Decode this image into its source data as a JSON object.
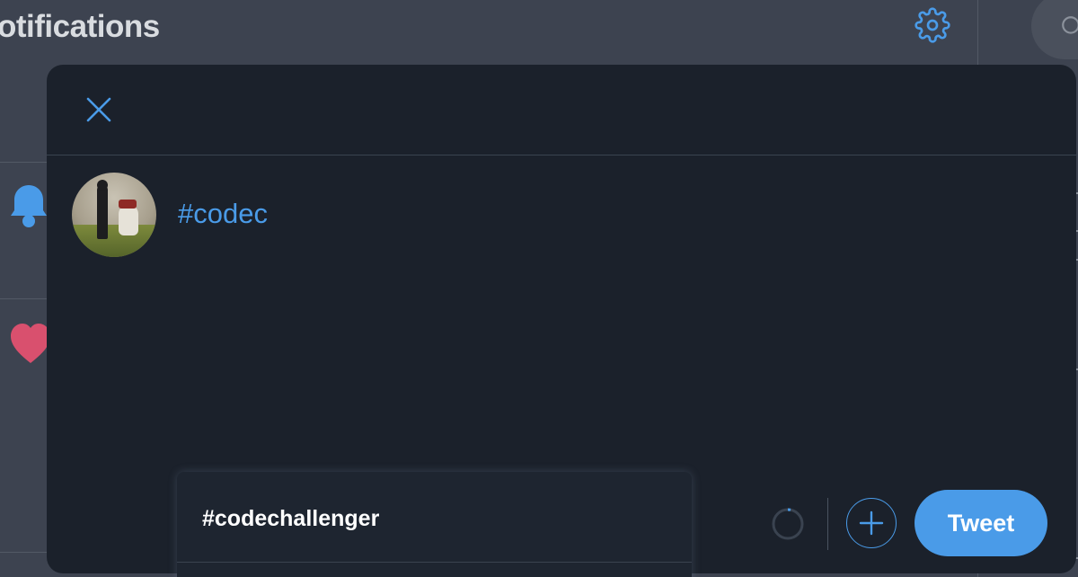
{
  "background": {
    "header_title": "otifications",
    "settings_icon": "gear-icon",
    "search_icon": "search-icon"
  },
  "modal": {
    "close_icon": "close-icon",
    "composer_text": "#codec",
    "suggestions": [
      {
        "label": "#codechallenger"
      }
    ],
    "add_icon": "plus-icon",
    "tweet_label": "Tweet"
  },
  "colors": {
    "accent": "#4a9be8",
    "modal_bg": "#1b212b",
    "page_bg": "#3d4350",
    "heart": "#d9506e"
  }
}
